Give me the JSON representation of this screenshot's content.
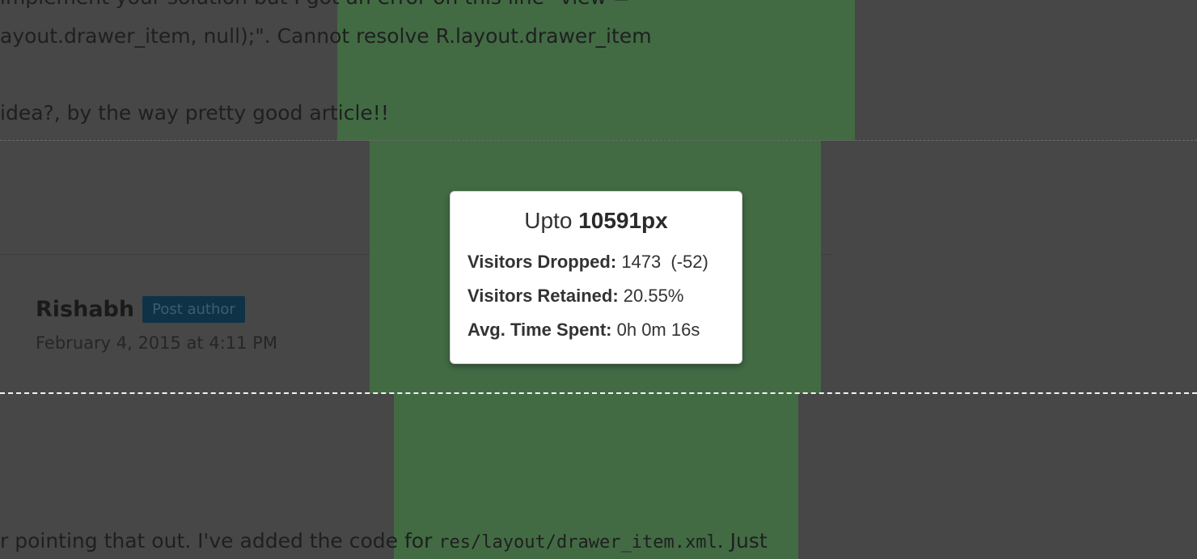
{
  "page": {
    "line_top_1": "implement your solution but I got an error on this line \"view =",
    "line_top_2": "ayout.drawer_item, null);\". Cannot resolve R.layout.drawer_item",
    "line_top_3": "idea?, by the way pretty good article!!",
    "author_name": "Rishabh",
    "author_badge": "Post author",
    "comment_date": "February 4, 2015 at 4:11 PM",
    "line_bottom_prefix": "r pointing that out. I've added the code for ",
    "line_bottom_code": "res/layout/drawer_item.xml",
    "line_bottom_suffix": ". Just"
  },
  "tooltip": {
    "title_prefix": "Upto",
    "title_value": "10591px",
    "visitors_dropped_label": "Visitors Dropped:",
    "visitors_dropped_value": "1473",
    "visitors_dropped_delta": "(-52)",
    "visitors_retained_label": "Visitors Retained:",
    "visitors_retained_value": "20.55%",
    "avg_time_label": "Avg. Time Spent:",
    "avg_time_value": "0h 0m 16s"
  },
  "colors": {
    "overlay_gray": "#474747",
    "heatmap_green": "#426b44",
    "badge_bg": "#0e3346",
    "marker_dashed": "#f2f2f2"
  }
}
